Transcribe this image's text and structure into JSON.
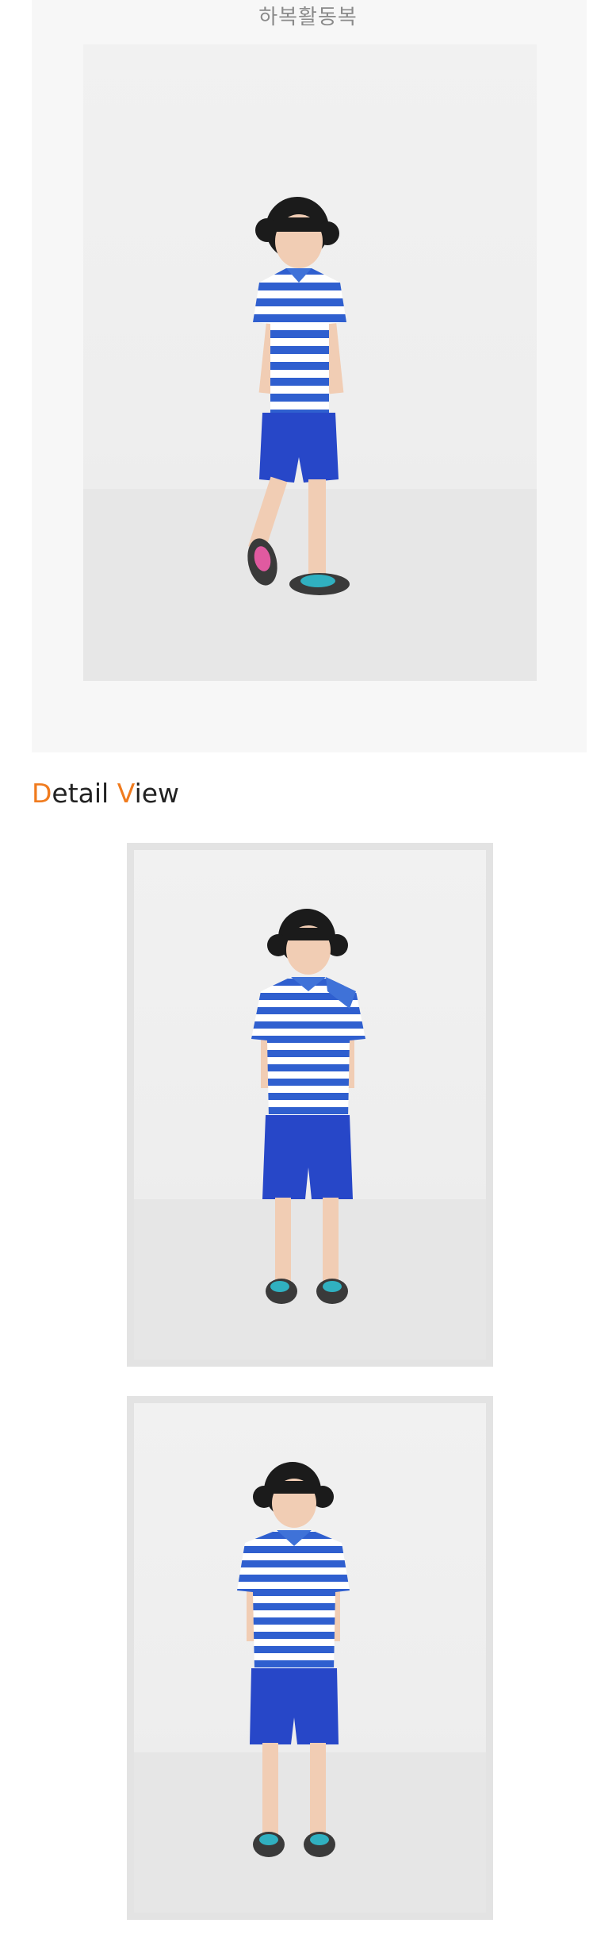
{
  "top_section": {
    "title": "하복활동복",
    "photo": {
      "subject": "child-standing-one-leg-raised",
      "shirt_color": "#2f5fcf",
      "shirt_stripe_color": "#ffffff",
      "shorts_color": "#2747c8"
    }
  },
  "detail_section": {
    "heading_first_letter_1": "D",
    "heading_rest_1": "etail ",
    "heading_first_letter_2": "V",
    "heading_rest_2": "iew",
    "accent_color": "#f07b1e",
    "photos": [
      {
        "subject": "child-standing-front-hands-in-pockets"
      },
      {
        "subject": "child-standing-front-straight"
      }
    ]
  }
}
